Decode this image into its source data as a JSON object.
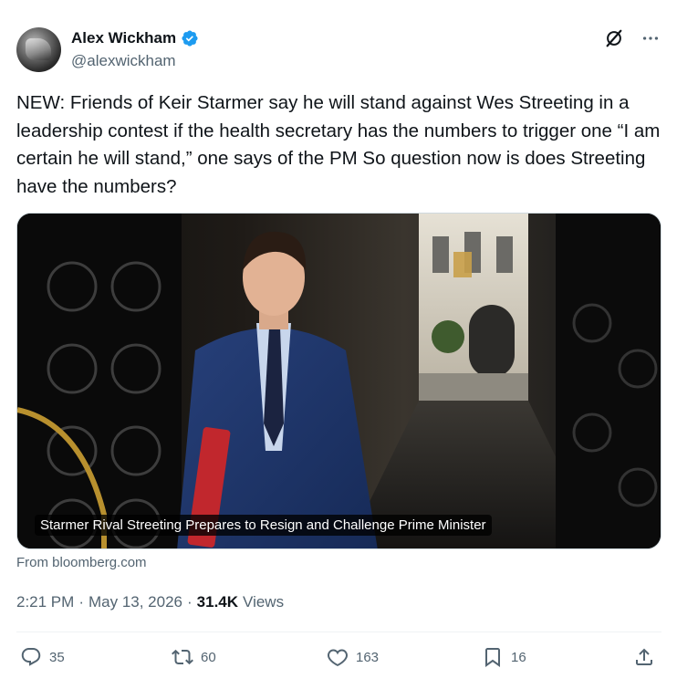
{
  "author": {
    "display_name": "Alex Wickham",
    "handle": "@alexwickham",
    "verified": true
  },
  "tweet": {
    "text": "NEW: Friends of Keir Starmer say he will stand against Wes Streeting in a leadership contest if the health secretary has the numbers to trigger one “I am certain he will stand,” one says of the PM So question now is does Streeting have the numbers?"
  },
  "card": {
    "caption": "Starmer Rival Streeting Prepares to Resign and Challenge Prime Minister",
    "source": "From bloomberg.com"
  },
  "meta": {
    "time": "2:21 PM",
    "separator": "·",
    "date": "May 13, 2026",
    "views_count": "31.4K",
    "views_label": "Views"
  },
  "actions": {
    "replies": "35",
    "reposts": "60",
    "likes": "163",
    "bookmarks": "16"
  },
  "colors": {
    "verified_blue": "#1d9bf0",
    "secondary_text": "#536471",
    "primary_text": "#0f1419"
  },
  "icons": [
    "verified-badge-icon",
    "grok-icon",
    "more-icon",
    "reply-icon",
    "repost-icon",
    "like-icon",
    "bookmark-icon",
    "share-icon"
  ]
}
